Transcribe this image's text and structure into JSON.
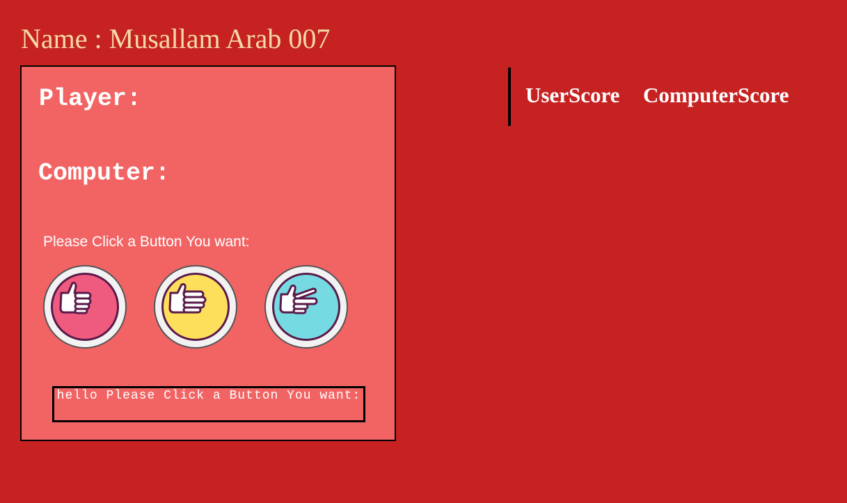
{
  "header": {
    "title": "Name : Musallam Arab 007"
  },
  "game": {
    "player_label": "Player:",
    "computer_label": "Computer:",
    "instruction": "Please Click a Button You want:",
    "buttons": [
      {
        "name": "rock",
        "icon": "fist-icon",
        "color": "#ef5a7f"
      },
      {
        "name": "paper",
        "icon": "open-hand-icon",
        "color": "#fedf5b"
      },
      {
        "name": "scissors",
        "icon": "peace-hand-icon",
        "color": "#76dae2"
      }
    ],
    "message": "hello Please Click a Button You want:"
  },
  "scoreboard": {
    "user_score_label": "UserScore",
    "computer_score_label": "ComputerScore"
  },
  "colors": {
    "background": "#c62222",
    "panel": "#f26464",
    "title_text": "#f6d9a8"
  }
}
